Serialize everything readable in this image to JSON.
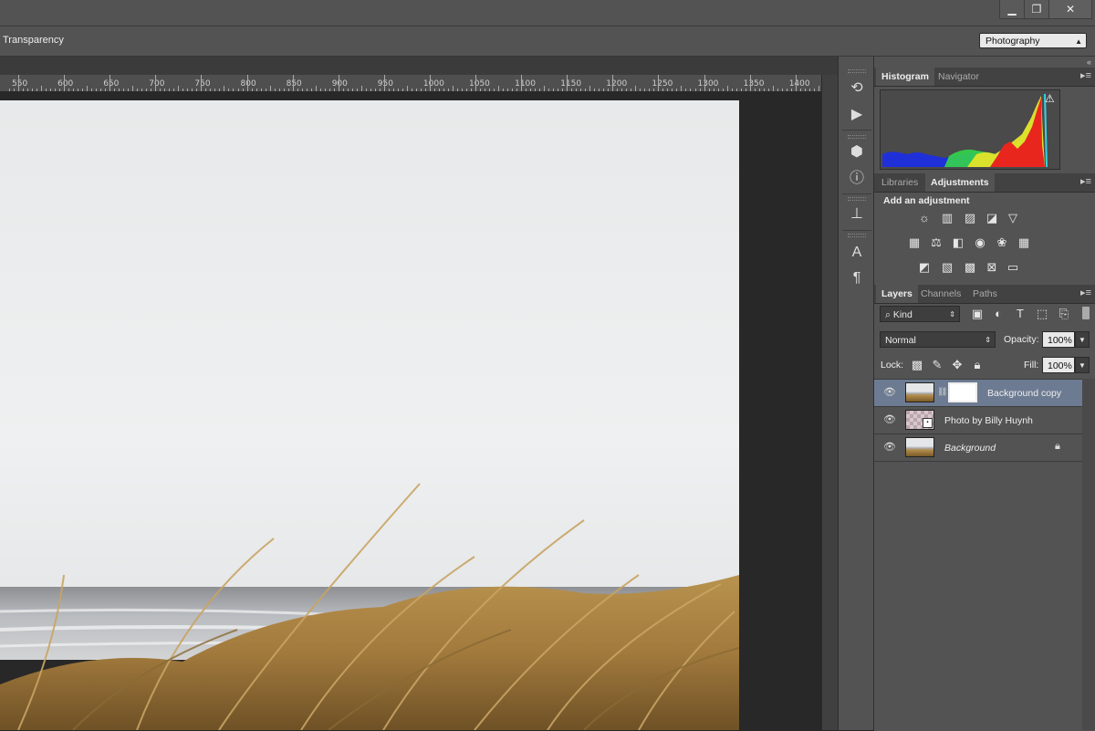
{
  "window": {
    "minimize_glyph": "▁",
    "restore_glyph": "❐",
    "close_glyph": "✕"
  },
  "options_bar": {
    "transparency_label": "Transparency",
    "workspace_value": "Photography"
  },
  "ruler": {
    "labels": [
      "550",
      "600",
      "650",
      "700",
      "750",
      "800",
      "850",
      "900",
      "950",
      "1000",
      "1050",
      "1100",
      "1150",
      "1200",
      "1250",
      "1300",
      "1350",
      "1400"
    ]
  },
  "panels": {
    "collapse_glyph": "«",
    "histogram": {
      "tabs": [
        "Histogram",
        "Navigator"
      ],
      "active_tab": "Histogram",
      "warning_glyph": "⚠"
    },
    "adjustments": {
      "tabs": [
        "Libraries",
        "Adjustments"
      ],
      "active_tab": "Adjustments",
      "title": "Add an adjustment"
    },
    "layers": {
      "tabs": [
        "Layers",
        "Channels",
        "Paths"
      ],
      "active_tab": "Layers",
      "filter_kind": "Kind",
      "blend_mode": "Normal",
      "opacity_label": "Opacity:",
      "opacity_value": "100%",
      "lock_label": "Lock:",
      "fill_label": "Fill:",
      "fill_value": "100%",
      "items": [
        {
          "name": "Background copy",
          "selected": true,
          "has_mask": true
        },
        {
          "name": "Photo by Billy Huynh",
          "selected": false,
          "smart_object": true
        },
        {
          "name": "Background",
          "selected": false,
          "locked": true
        }
      ]
    }
  },
  "icons": {
    "strip": [
      "history-icon",
      "actions-play-icon",
      "3d-icon",
      "info-icon",
      "clone-source-icon",
      "character-icon",
      "paragraph-icon"
    ],
    "adjustments_row1": [
      "brightness-contrast-icon",
      "levels-icon",
      "curves-icon",
      "exposure-icon",
      "vibrance-icon"
    ],
    "adjustments_row2": [
      "hue-saturation-icon",
      "color-balance-icon",
      "black-white-icon",
      "photo-filter-icon",
      "channel-mixer-icon",
      "color-lookup-icon"
    ],
    "adjustments_row3": [
      "invert-icon",
      "posterize-icon",
      "threshold-icon",
      "selective-color-icon",
      "gradient-map-icon"
    ]
  },
  "colors": {
    "ui_bg": "#535353",
    "dark_bg": "#282828",
    "selected_layer": "#6d7b92"
  }
}
